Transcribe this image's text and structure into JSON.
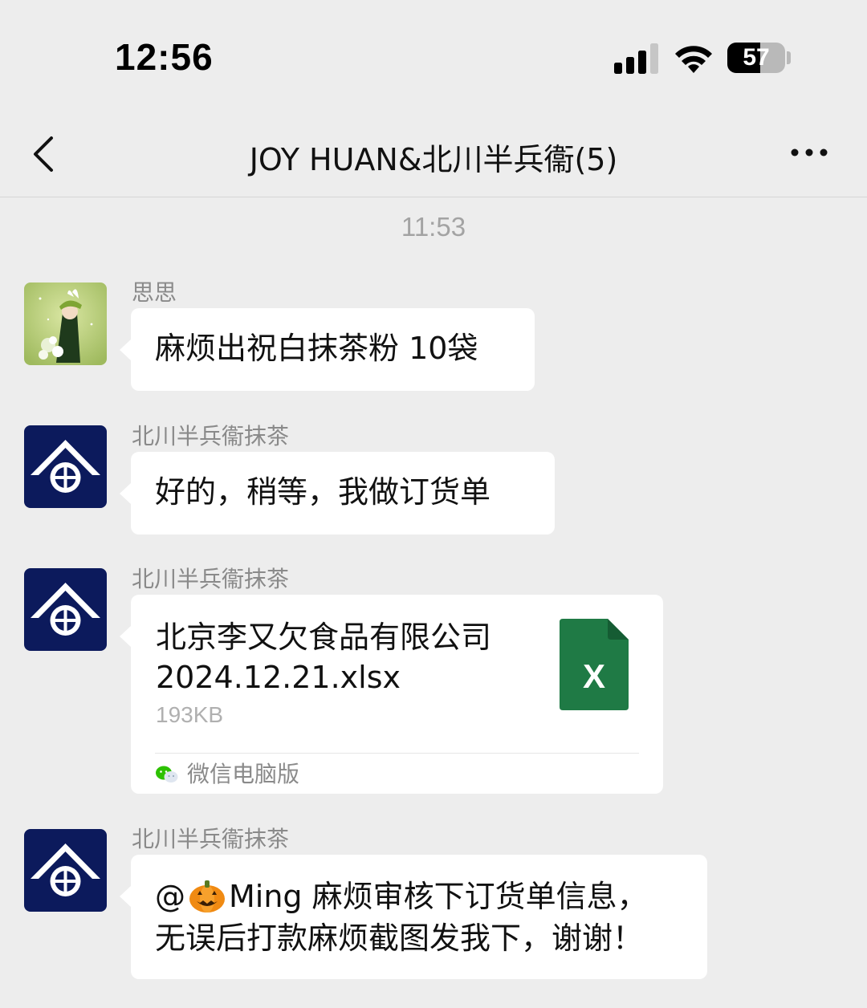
{
  "status_bar": {
    "time": "12:56",
    "battery_level": "57",
    "icons": [
      "signal-icon",
      "wifi-icon",
      "battery-icon"
    ]
  },
  "nav": {
    "back_icon": "chevron-left-icon",
    "title": "JOY HUAN&北川半兵衞(5)",
    "more_icon": "more-dots-icon"
  },
  "chat": {
    "timestamp": "11:53",
    "messages": [
      {
        "sender": "思思",
        "avatar": "user-avatar-girl",
        "text": "麻烦出祝白抹茶粉 10袋"
      },
      {
        "sender": "北川半兵衞抹茶",
        "avatar": "brand-logo-avatar",
        "text": "好的，稍等，我做订货单"
      },
      {
        "sender": "北川半兵衞抹茶",
        "avatar": "brand-logo-avatar",
        "file": {
          "name": "北京李又欠食品有限公司2024.12.21.xlsx",
          "size": "193KB",
          "icon": "excel-file-icon",
          "icon_letter": "X",
          "source": "微信电脑版",
          "source_icon": "wechat-icon"
        }
      },
      {
        "sender": "北川半兵衞抹茶",
        "avatar": "brand-logo-avatar",
        "text_prefix": "@",
        "mention_icon": "pumpkin-emoji",
        "line1_rest": "Ming 麻烦审核下订货单信息，",
        "line2": "无误后打款麻烦截图发我下，谢谢！"
      }
    ]
  },
  "colors": {
    "background": "#ededed",
    "bubble": "#ffffff",
    "brand_navy": "#0c1a5c",
    "excel_green": "#1f7a45"
  }
}
